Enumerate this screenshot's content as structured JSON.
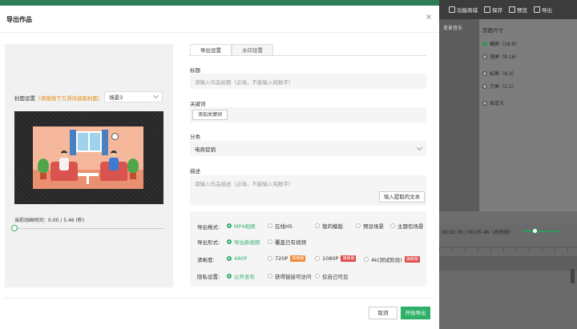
{
  "background": {
    "toolbar": [
      {
        "label": "功能商城",
        "icon": "store-icon"
      },
      {
        "label": "保存",
        "icon": "save-icon"
      },
      {
        "label": "预览",
        "icon": "preview-icon"
      },
      {
        "label": "导出",
        "icon": "export-icon"
      }
    ],
    "music_label": "背景音乐",
    "page_size_title": "页面尺寸",
    "page_sizes": [
      {
        "label": "横屏（16:9）",
        "selected": true
      },
      {
        "label": "竖屏（9:16）",
        "selected": false
      },
      {
        "label": "标屏（4:3）",
        "selected": false
      },
      {
        "label": "方屏（1:1）",
        "selected": false
      },
      {
        "label": "自定义",
        "selected": false
      }
    ],
    "timeline_time": "00:02.76 / 00:05.46（总时间）"
  },
  "modal": {
    "title": "导出作品",
    "close_glyph": "×",
    "cover": {
      "label": "封面设置",
      "hint": "（请拖拽下方滑块选取封面）",
      "scene_value": "场景3"
    },
    "current_time_label": "当前动画时间：0.00 / 5.46 (秒)",
    "progress_fraction": 0,
    "tabs": [
      {
        "label": "导出设置",
        "active": true
      },
      {
        "label": "水印设置",
        "active": false
      }
    ],
    "fields": {
      "title_label": "标题",
      "title_placeholder": "请输入作品标题（必填，不能输入纯数字）",
      "keywords_label": "关键词",
      "add_keyword": "添加关键词",
      "category_label": "分类",
      "category_value": "电商促销",
      "desc_label": "描述",
      "desc_placeholder": "请输入作品描述（必填，不能输入纯数字）",
      "extract_button": "填入提取的文本"
    },
    "options": {
      "format": {
        "label": "导出格式:",
        "items": [
          {
            "label": "MP4视频",
            "selected": true
          },
          {
            "label": "在线H5",
            "selected": false
          },
          {
            "label": "我的模版",
            "selected": false
          },
          {
            "label": "预设场景",
            "selected": false
          },
          {
            "label": "主题包场景",
            "selected": false
          }
        ]
      },
      "mode": {
        "label": "导出形式:",
        "items": [
          {
            "label": "导出新视频",
            "selected": true
          },
          {
            "label": "覆盖已有视频",
            "selected": false
          }
        ]
      },
      "resolution": {
        "label": "清晰度:",
        "items": [
          {
            "label": "480P",
            "selected": true,
            "badge": ""
          },
          {
            "label": "720P",
            "selected": false,
            "badge": "高级版",
            "badge_color": "#f0883a"
          },
          {
            "label": "1080P",
            "selected": false,
            "badge": "旗舰版",
            "badge_color": "#e04848"
          },
          {
            "label": "4k(测试阶段)",
            "selected": false,
            "badge": "旗舰版",
            "badge_color": "#e04848"
          }
        ]
      },
      "privacy": {
        "label": "隐私设置:",
        "items": [
          {
            "label": "公开发布",
            "selected": true
          },
          {
            "label": "获得链接可访问",
            "selected": false
          },
          {
            "label": "仅自己可见",
            "selected": false
          }
        ]
      }
    },
    "cancel_button": "取消",
    "export_button": "开始导出",
    "accent_color": "#2fb069"
  }
}
